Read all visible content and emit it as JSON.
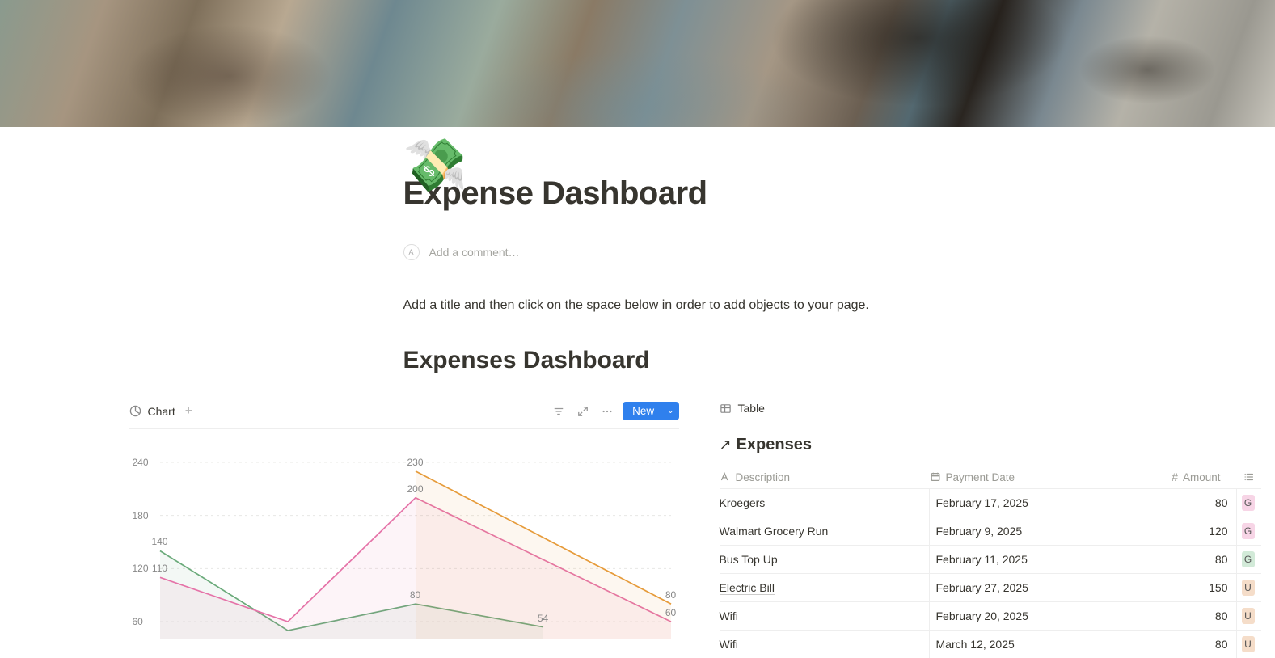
{
  "page": {
    "icon": "💸",
    "title": "Expense Dashboard",
    "comment_placeholder": "Add a comment…",
    "avatar_initial": "A",
    "instruction": "Add a title and then click on the space below in order to add objects to your page.",
    "section_heading": "Expenses Dashboard"
  },
  "chart_view": {
    "label": "Chart",
    "new_button": "New"
  },
  "table_view": {
    "label": "Table",
    "title": "Expenses",
    "columns": {
      "description": "Description",
      "payment_date": "Payment Date",
      "amount": "Amount"
    },
    "rows": [
      {
        "description": "Kroegers",
        "payment_date": "February 17, 2025",
        "amount": "80",
        "tag_letter": "G",
        "tag_color": "pink"
      },
      {
        "description": "Walmart Grocery Run",
        "payment_date": "February 9, 2025",
        "amount": "120",
        "tag_letter": "G",
        "tag_color": "pink"
      },
      {
        "description": "Bus Top Up",
        "payment_date": "February 11, 2025",
        "amount": "80",
        "tag_letter": "G",
        "tag_color": "green"
      },
      {
        "description": "Electric Bill",
        "payment_date": "February 27, 2025",
        "amount": "150",
        "tag_letter": "U",
        "tag_color": "orange",
        "underline": true
      },
      {
        "description": "Wifi",
        "payment_date": "February 20, 2025",
        "amount": "80",
        "tag_letter": "U",
        "tag_color": "orange"
      },
      {
        "description": "Wifi",
        "payment_date": "March 12, 2025",
        "amount": "80",
        "tag_letter": "U",
        "tag_color": "orange"
      }
    ]
  },
  "chart_data": {
    "type": "line",
    "ylim": [
      40,
      250
    ],
    "y_ticks": [
      240,
      180,
      120,
      60
    ],
    "x_points": 5,
    "series": [
      {
        "name": "series_green",
        "color": "#6aaa7a",
        "values": [
          140,
          50,
          80,
          54,
          null
        ],
        "labels": [
          140,
          null,
          80,
          54,
          null
        ]
      },
      {
        "name": "series_pink",
        "color": "#e573a8",
        "values": [
          110,
          60,
          200,
          null,
          60
        ],
        "labels": [
          110,
          null,
          200,
          null,
          60
        ]
      },
      {
        "name": "series_orange",
        "color": "#e69b3a",
        "values": [
          null,
          null,
          230,
          null,
          80
        ],
        "labels": [
          null,
          null,
          230,
          null,
          80
        ]
      }
    ]
  }
}
